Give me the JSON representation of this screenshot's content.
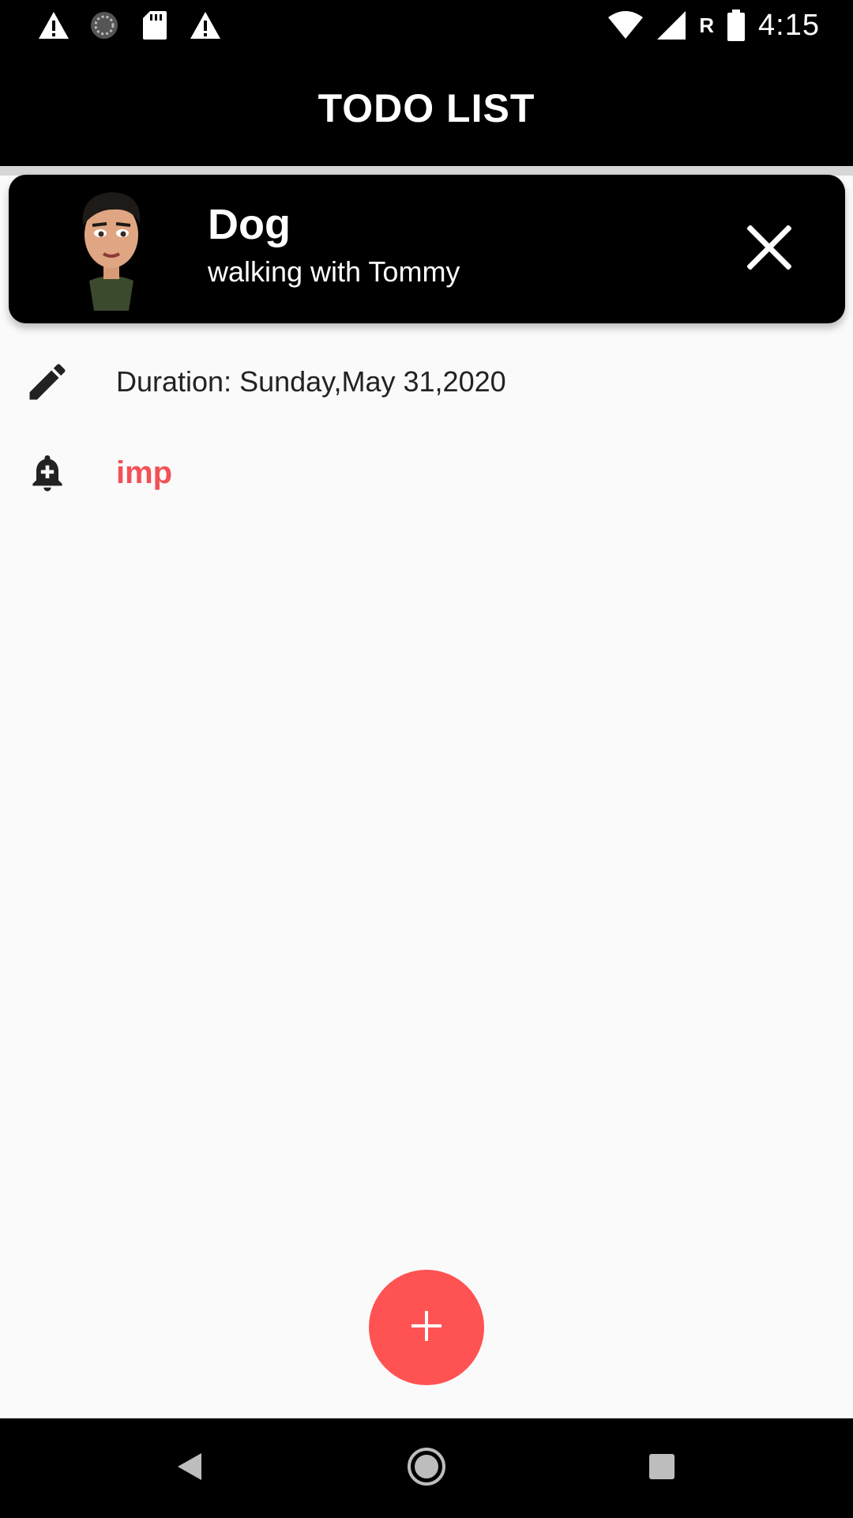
{
  "status_bar": {
    "time": "4:15",
    "network_label": "R",
    "left_icons": [
      "warning-icon",
      "sync-icon",
      "sd-card-icon",
      "warning-icon"
    ],
    "right_icons": [
      "wifi-icon",
      "signal-icon",
      "battery-icon"
    ]
  },
  "app_bar": {
    "title": "TODO LIST"
  },
  "todo_card": {
    "title": "Dog",
    "subtitle": "walking with Tommy",
    "avatar_icon": "avatar",
    "close_icon": "close-icon"
  },
  "details": {
    "duration_text": "Duration: Sunday,May 31,2020",
    "duration_icon": "edit-icon",
    "tag_text": "imp",
    "tag_icon": "bell-plus-icon",
    "tag_color": "#f25157"
  },
  "fab": {
    "icon": "add-icon",
    "color": "#ff5252"
  },
  "nav_bar": {
    "buttons": [
      "back-icon",
      "home-icon",
      "recents-icon"
    ]
  },
  "colors": {
    "app_bar": "#000000",
    "card": "#000000",
    "background": "#fafafa"
  }
}
